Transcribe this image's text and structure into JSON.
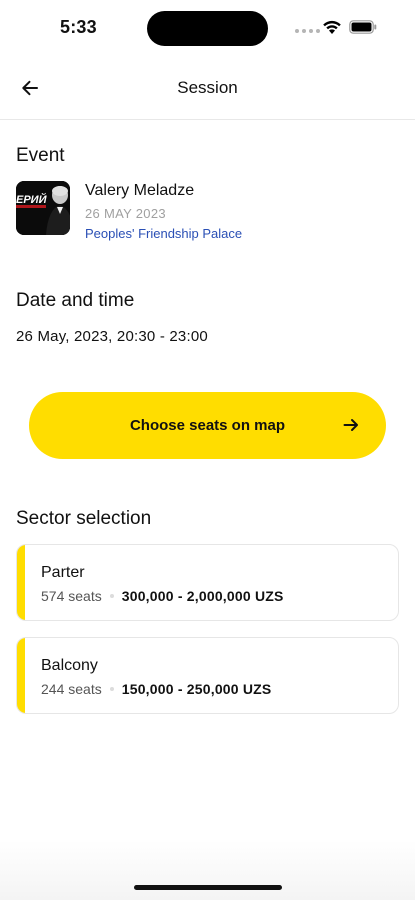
{
  "status_bar": {
    "time": "5:33"
  },
  "header": {
    "title": "Session",
    "back_icon": "arrow-left-icon"
  },
  "event": {
    "section_title": "Event",
    "name": "Valery Meladze",
    "date": "26 MAY 2023",
    "venue": "Peoples' Friendship Palace",
    "poster_text": "ЕРИЙ"
  },
  "datetime": {
    "section_title": "Date and time",
    "value": "26 May, 2023, 20:30 - 23:00"
  },
  "seats_button": {
    "label": "Choose seats on map",
    "icon": "arrow-right-icon"
  },
  "sectors": {
    "section_title": "Sector selection",
    "items": [
      {
        "name": "Parter",
        "seats": "574 seats",
        "price": "300,000 - 2,000,000 UZS"
      },
      {
        "name": "Balcony",
        "seats": "244 seats",
        "price": "150,000 - 250,000 UZS"
      }
    ]
  },
  "colors": {
    "accent": "#ffdd00",
    "link": "#2a4fb5"
  }
}
